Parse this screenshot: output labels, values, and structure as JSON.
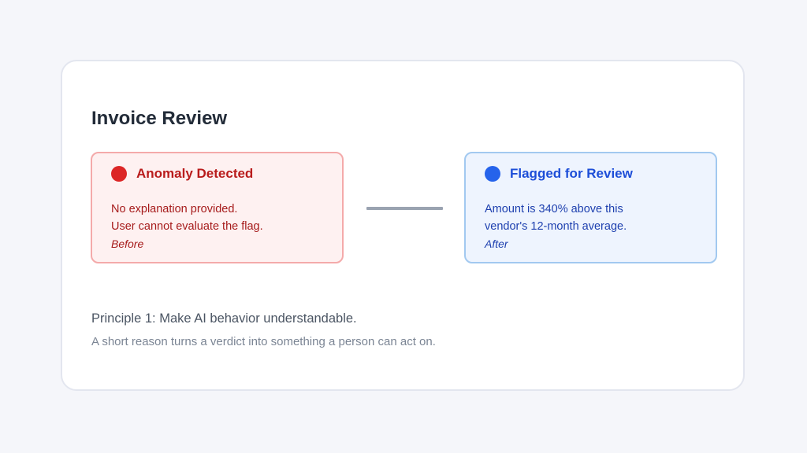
{
  "card": {
    "title": "Invoice Review"
  },
  "before": {
    "heading": "Anomaly Detected",
    "lines": [
      "No explanation provided.",
      "User cannot evaluate the flag."
    ],
    "caption": "Before",
    "accent": "#dc2626"
  },
  "after": {
    "heading": "Flagged for Review",
    "lines": [
      "Amount is 340% above this",
      "vendor's 12-month average."
    ],
    "caption": "After",
    "accent": "#2563eb"
  },
  "principle": {
    "title": "Principle 1: Make AI behavior understandable.",
    "subtitle": "A short reason turns a verdict into something a person can act on."
  }
}
